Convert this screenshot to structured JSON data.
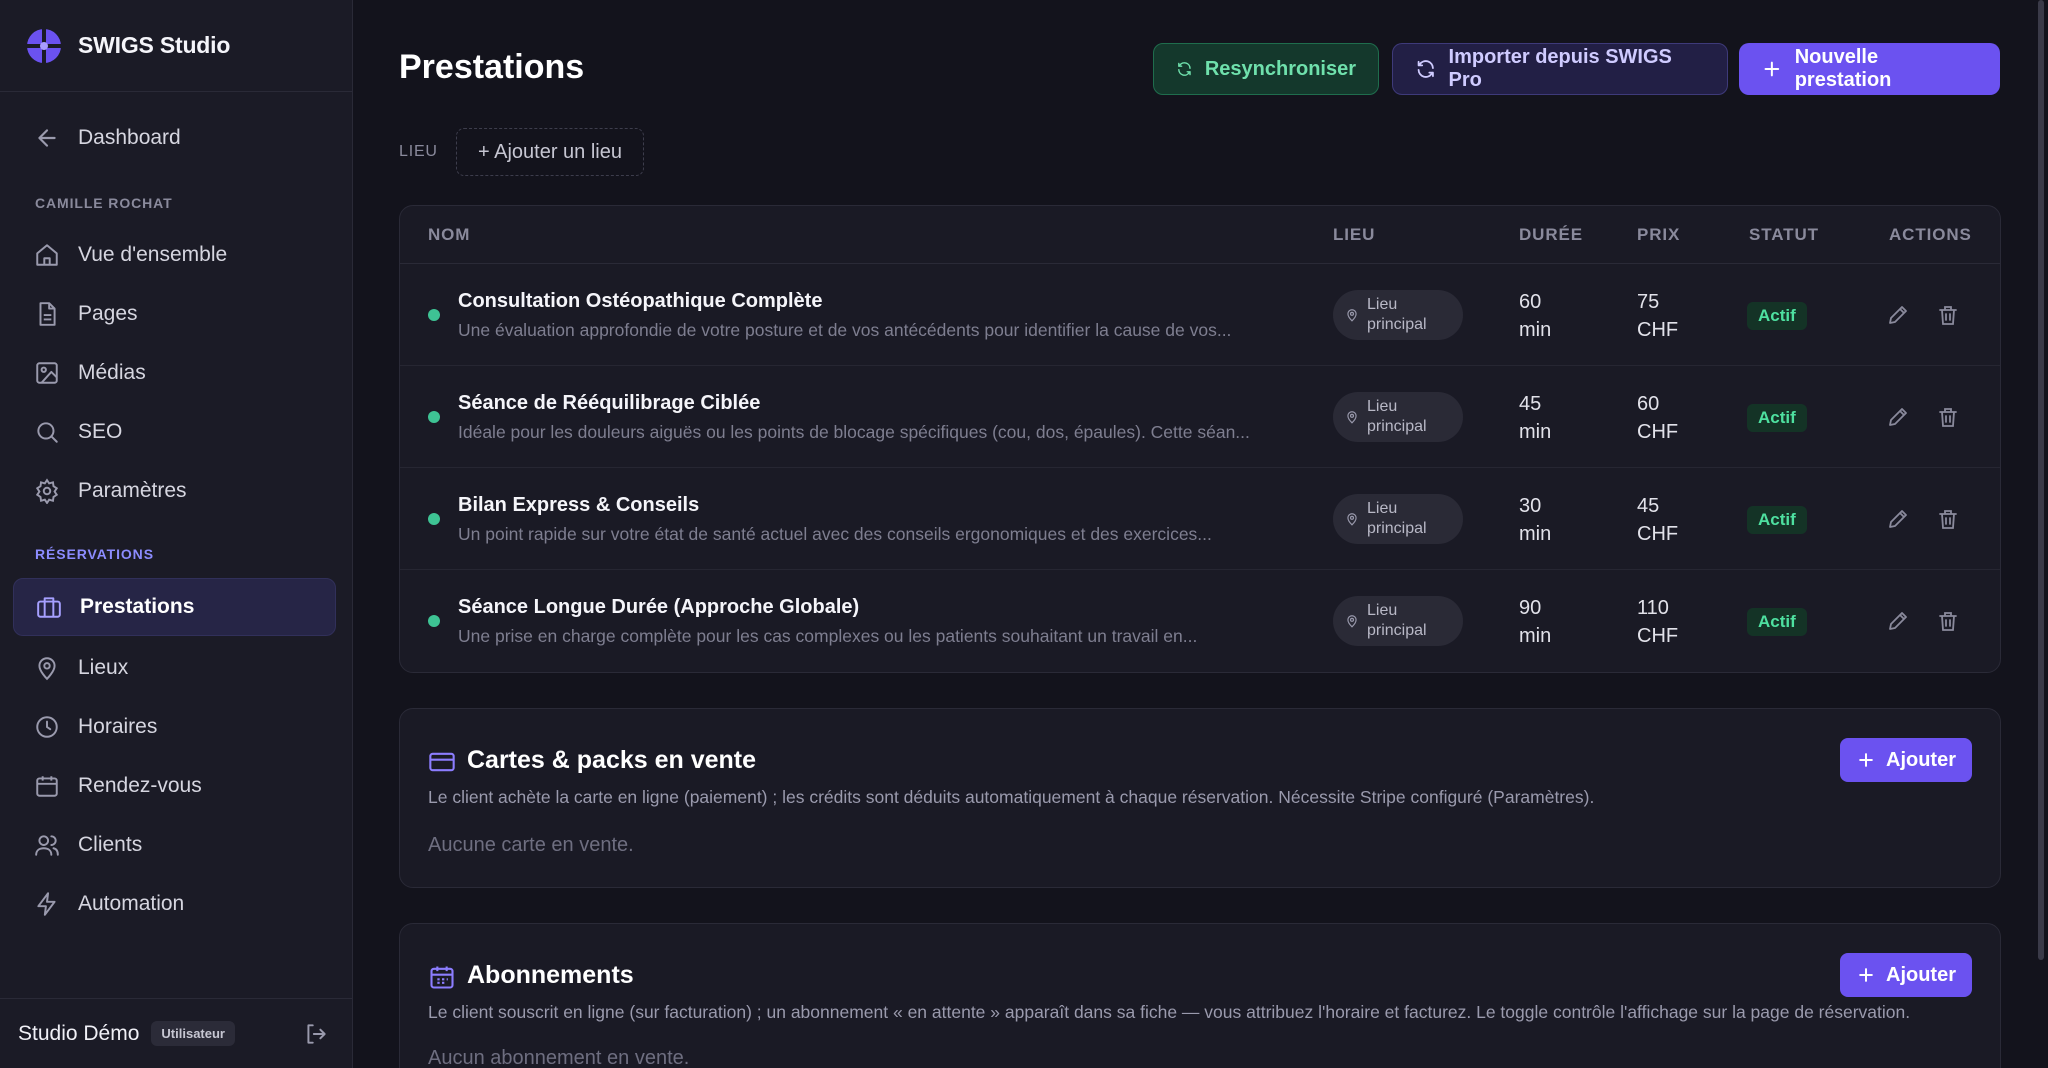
{
  "app": {
    "name": "SWIGS Studio"
  },
  "sidebar": {
    "back_label": "Dashboard",
    "account_section": "CAMILLE ROCHAT",
    "items": [
      {
        "label": "Vue d'ensemble",
        "icon": "home-icon"
      },
      {
        "label": "Pages",
        "icon": "document-icon"
      },
      {
        "label": "Médias",
        "icon": "image-icon"
      },
      {
        "label": "SEO",
        "icon": "search-icon"
      },
      {
        "label": "Paramètres",
        "icon": "gear-icon"
      }
    ],
    "reservations_section": "RÉSERVATIONS",
    "reservation_items": [
      {
        "label": "Prestations",
        "icon": "briefcase-icon",
        "active": true
      },
      {
        "label": "Lieux",
        "icon": "map-pin-icon"
      },
      {
        "label": "Horaires",
        "icon": "clock-icon"
      },
      {
        "label": "Rendez-vous",
        "icon": "calendar-icon"
      },
      {
        "label": "Clients",
        "icon": "users-icon"
      },
      {
        "label": "Automation",
        "icon": "lightning-icon"
      }
    ],
    "footer": {
      "name": "Studio Démo",
      "role": "Utilisateur"
    }
  },
  "header": {
    "title": "Prestations",
    "resync_label": "Resynchroniser",
    "import_label": "Importer depuis SWIGS Pro",
    "new_label": "Nouvelle prestation"
  },
  "filter": {
    "label": "LIEU",
    "add_label": "+ Ajouter un lieu"
  },
  "table": {
    "columns": [
      "NOM",
      "LIEU",
      "DURÉE",
      "PRIX",
      "STATUT",
      "ACTIONS"
    ],
    "rows": [
      {
        "name": "Consultation Ostéopathique Complète",
        "desc": "Une évaluation approfondie de votre posture et de vos antécédents pour identifier la cause de vos...",
        "lieu_1": "Lieu",
        "lieu_2": "principal",
        "duree_1": "60",
        "duree_2": "min",
        "prix_1": "75",
        "prix_2": "CHF",
        "statut": "Actif"
      },
      {
        "name": "Séance de Rééquilibrage Ciblée",
        "desc": "Idéale pour les douleurs aiguës ou les points de blocage spécifiques (cou, dos, épaules). Cette séan...",
        "lieu_1": "Lieu",
        "lieu_2": "principal",
        "duree_1": "45",
        "duree_2": "min",
        "prix_1": "60",
        "prix_2": "CHF",
        "statut": "Actif"
      },
      {
        "name": "Bilan Express & Conseils",
        "desc": "Un point rapide sur votre état de santé actuel avec des conseils ergonomiques et des exercices...",
        "lieu_1": "Lieu",
        "lieu_2": "principal",
        "duree_1": "30",
        "duree_2": "min",
        "prix_1": "45",
        "prix_2": "CHF",
        "statut": "Actif"
      },
      {
        "name": "Séance Longue Durée (Approche Globale)",
        "desc": "Une prise en charge complète pour les cas complexes ou les patients souhaitant un travail en...",
        "lieu_1": "Lieu",
        "lieu_2": "principal",
        "duree_1": "90",
        "duree_2": "min",
        "prix_1": "110",
        "prix_2": "CHF",
        "statut": "Actif"
      }
    ]
  },
  "cartes": {
    "title": "Cartes & packs en vente",
    "desc": "Le client achète la carte en ligne (paiement) ; les crédits sont déduits automatiquement à chaque réservation. Nécessite Stripe configuré (Paramètres).",
    "empty": "Aucune carte en vente.",
    "add_label": "Ajouter"
  },
  "abonnements": {
    "title": "Abonnements",
    "desc": "Le client souscrit en ligne (sur facturation) ; un abonnement « en attente » apparaît dans sa fiche — vous attribuez l'horaire et facturez. Le toggle contrôle l'affichage sur la page de réservation.",
    "empty": "Aucun abonnement en vente.",
    "add_label": "Ajouter"
  },
  "colors": {
    "accent": "#6b52f0",
    "success": "#3ec394",
    "background": "#13131c",
    "sidebar": "#1b1b26"
  }
}
